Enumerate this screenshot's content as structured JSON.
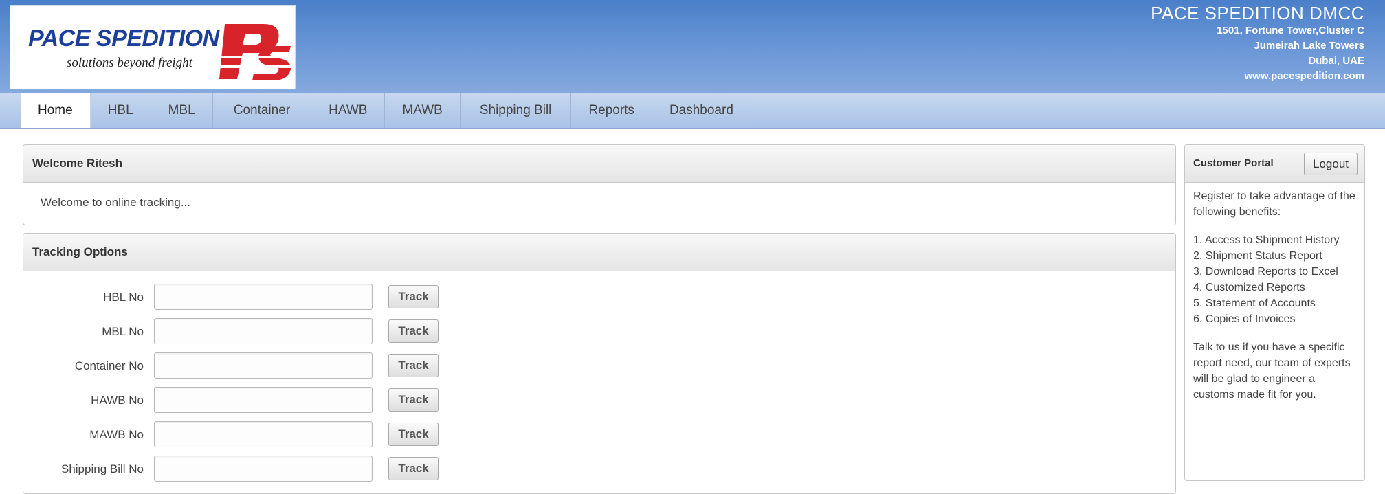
{
  "header": {
    "logo_title": "PACE SPEDITION",
    "logo_tagline": "solutions beyond freight",
    "logo_mark": "PS",
    "company_name": "PACE SPEDITION DMCC",
    "address_lines": [
      "1501, Fortune Tower,Cluster C",
      "Jumeirah Lake Towers",
      "Dubai, UAE",
      "www.pacespedition.com"
    ]
  },
  "nav": {
    "tabs": [
      {
        "label": "Home",
        "active": true
      },
      {
        "label": "HBL"
      },
      {
        "label": "MBL"
      },
      {
        "label": "Container"
      },
      {
        "label": "HAWB"
      },
      {
        "label": "MAWB"
      },
      {
        "label": "Shipping Bill"
      },
      {
        "label": "Reports"
      },
      {
        "label": "Dashboard"
      }
    ]
  },
  "welcome": {
    "title": "Welcome Ritesh",
    "text": "Welcome to online tracking..."
  },
  "tracking": {
    "title": "Tracking Options",
    "button_label": "Track",
    "fields": [
      {
        "label": "HBL No",
        "value": ""
      },
      {
        "label": "MBL No",
        "value": ""
      },
      {
        "label": "Container No",
        "value": ""
      },
      {
        "label": "HAWB No",
        "value": ""
      },
      {
        "label": "MAWB No",
        "value": ""
      },
      {
        "label": "Shipping Bill No",
        "value": ""
      }
    ]
  },
  "portal": {
    "title": "Customer Portal",
    "logout_label": "Logout",
    "intro": "Register to take advantage of the following benefits:",
    "benefits": [
      "1. Access to Shipment History",
      "2. Shipment Status Report",
      "3. Download Reports to Excel",
      "4. Customized Reports",
      "5. Statement of Accounts",
      "6. Copies of Invoices"
    ],
    "outro": "Talk to us if you have a specific report need, our team of experts will be glad to engineer a customs made fit for you."
  },
  "colors": {
    "header_blue": "#4a7fc9",
    "logo_blue": "#1b3f9b",
    "logo_red": "#d8232a"
  }
}
